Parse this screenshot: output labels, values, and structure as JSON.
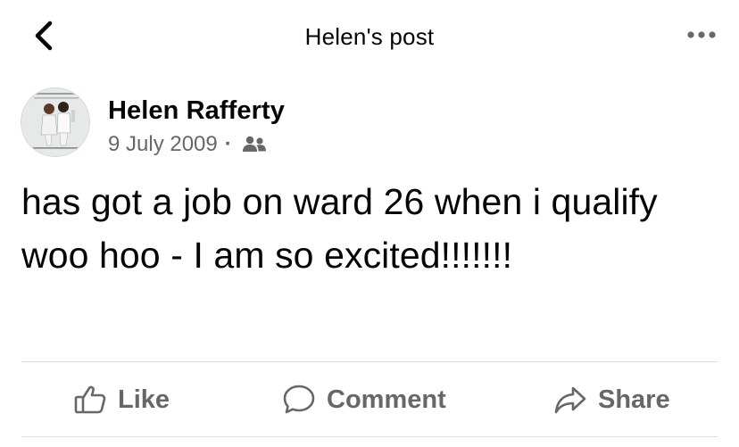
{
  "header": {
    "title": "Helen's post",
    "back_icon": "chevron-left-icon",
    "more_icon": "more-dots-icon"
  },
  "post": {
    "author": "Helen Rafferty",
    "date": "9 July 2009",
    "separator": "·",
    "audience_icon": "friends-icon",
    "text": "has got a job on ward 26 when i qualify woo hoo - I am so excited!!!!!!!"
  },
  "actions": {
    "like_label": "Like",
    "comment_label": "Comment",
    "share_label": "Share"
  },
  "colors": {
    "text": "#050505",
    "secondary": "#65676b",
    "divider": "#dadde1"
  }
}
